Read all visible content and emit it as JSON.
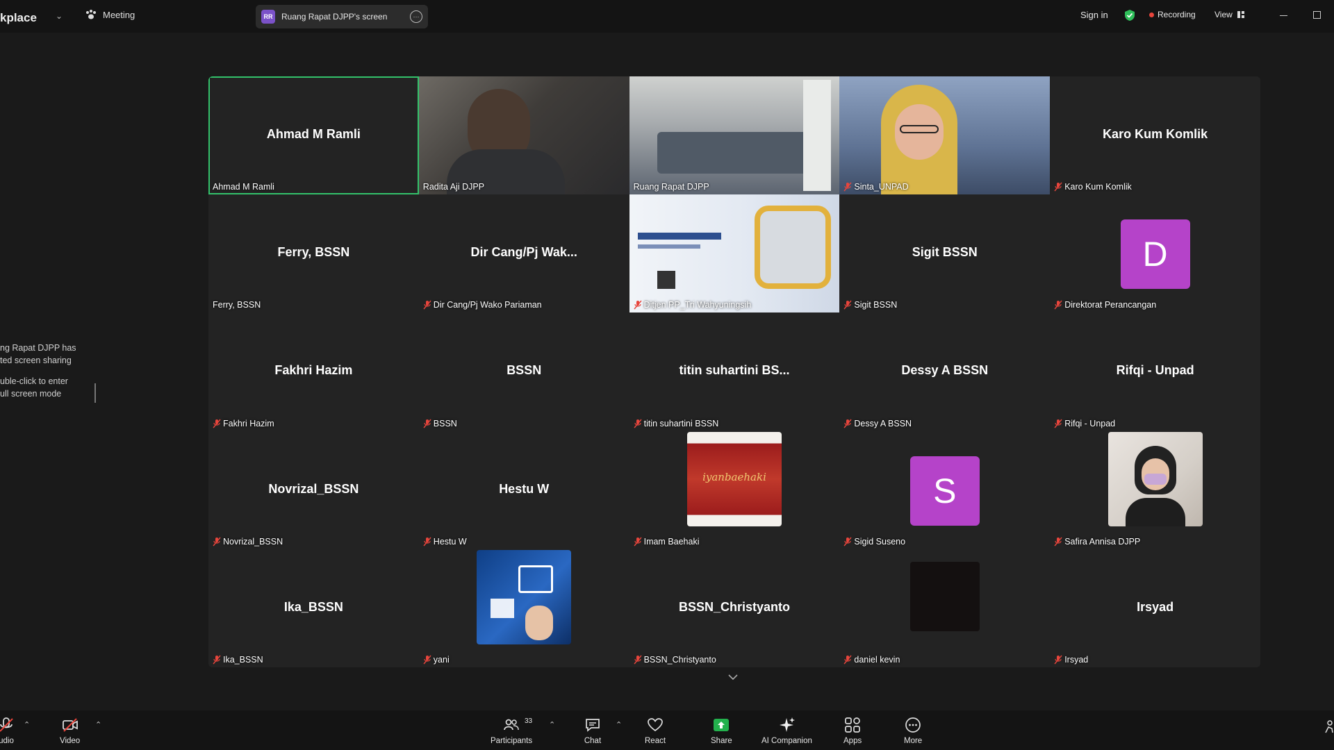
{
  "topbar": {
    "app_title": "kplace",
    "meeting_label": "Meeting",
    "share_badge": "RR",
    "share_label": "Ruang Rapat DJPP's screen",
    "signin": "Sign in",
    "recording": "Recording",
    "view": "View"
  },
  "notice": {
    "line1": "ng Rapat DJPP has",
    "line2": "ted screen sharing",
    "line3": "uble-click to enter",
    "line4": "ull screen mode"
  },
  "tiles": [
    {
      "name": "Ahmad M Ramli",
      "label": "Ahmad M Ramli",
      "muted": false,
      "type": "name",
      "active": true
    },
    {
      "name": "",
      "label": "Radita Aji DJPP",
      "muted": false,
      "type": "video"
    },
    {
      "name": "",
      "label": "Ruang Rapat DJPP",
      "muted": false,
      "type": "video"
    },
    {
      "name": "",
      "label": "Sinta_UNPAD",
      "muted": true,
      "type": "video"
    },
    {
      "name": "Karo Kum Komlik",
      "label": "Karo Kum Komlik",
      "muted": true,
      "type": "name"
    },
    {
      "name": "Ferry, BSSN",
      "label": "Ferry, BSSN",
      "muted": false,
      "type": "name"
    },
    {
      "name": "Dir Cang/Pj Wak...",
      "label": "Dir Cang/Pj Wako Pariaman",
      "muted": true,
      "type": "name"
    },
    {
      "name": "",
      "label": "Ditjen PP_Tri Wahyuningsih",
      "muted": true,
      "type": "video"
    },
    {
      "name": "Sigit BSSN",
      "label": "Sigit BSSN",
      "muted": true,
      "type": "name"
    },
    {
      "name": "",
      "label": "Direktorat Perancangan",
      "muted": true,
      "type": "avatar",
      "letter": "D"
    },
    {
      "name": "Fakhri Hazim",
      "label": "Fakhri Hazim",
      "muted": true,
      "type": "name"
    },
    {
      "name": "BSSN",
      "label": "BSSN",
      "muted": true,
      "type": "name"
    },
    {
      "name": "titin suhartini BS...",
      "label": "titin suhartini BSSN",
      "muted": true,
      "type": "name"
    },
    {
      "name": "Dessy A BSSN",
      "label": "Dessy A BSSN",
      "muted": true,
      "type": "name"
    },
    {
      "name": "Rifqi - Unpad",
      "label": "Rifqi - Unpad",
      "muted": true,
      "type": "name"
    },
    {
      "name": "Novrizal_BSSN",
      "label": "Novrizal_BSSN",
      "muted": true,
      "type": "name"
    },
    {
      "name": "Hestu W",
      "label": "Hestu W",
      "muted": true,
      "type": "name"
    },
    {
      "name": "",
      "label": "Imam Baehaki",
      "muted": true,
      "type": "thumb",
      "thumb_text": "iyanbaehaki"
    },
    {
      "name": "",
      "label": "Sigid Suseno",
      "muted": true,
      "type": "avatar",
      "letter": "S"
    },
    {
      "name": "",
      "label": "Safira Annisa DJPP",
      "muted": true,
      "type": "thumb"
    },
    {
      "name": "Ika_BSSN",
      "label": "Ika_BSSN",
      "muted": true,
      "type": "name"
    },
    {
      "name": "",
      "label": "yani",
      "muted": true,
      "type": "thumb"
    },
    {
      "name": "BSSN_Christyanto",
      "label": "BSSN_Christyanto",
      "muted": true,
      "type": "name"
    },
    {
      "name": "",
      "label": "daniel kevin",
      "muted": true,
      "type": "thumb"
    },
    {
      "name": "Irsyad",
      "label": "Irsyad",
      "muted": true,
      "type": "name"
    }
  ],
  "toolbar": {
    "audio": "udio",
    "video": "Video",
    "participants": "Participants",
    "participants_count": "33",
    "chat": "Chat",
    "react": "React",
    "share": "Share",
    "ai_companion": "AI Companion",
    "apps": "Apps",
    "more": "More"
  },
  "colors": {
    "active_border": "#33c26b",
    "avatar_purple": "#b543c9",
    "share_green": "#23b14d",
    "record_red": "#e8453c"
  }
}
